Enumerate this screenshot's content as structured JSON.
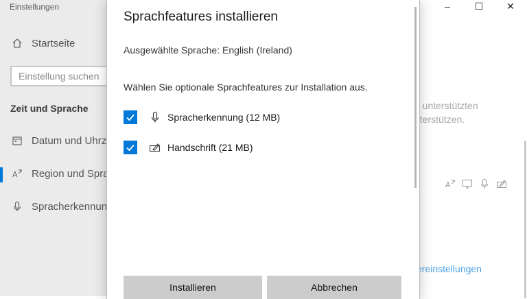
{
  "settings": {
    "app_title": "Einstellungen",
    "home_label": "Startseite",
    "search_placeholder": "Einstellung suchen",
    "section_heading": "Zeit und Sprache",
    "nav": [
      {
        "label": "Datum und Uhrz",
        "icon": "calendar-icon"
      },
      {
        "label": "Region und Spra",
        "icon": "region-language-icon"
      },
      {
        "label": "Spracherkennun",
        "icon": "microphone-icon"
      }
    ],
    "right_text_1": "n unterstützten",
    "right_text_2": "nterstützen.",
    "right_link": "ereinstellungen",
    "right_feature_icons": [
      "text-to-speech-icon",
      "display-language-icon",
      "microphone-icon",
      "handwriting-icon"
    ]
  },
  "window_controls": {
    "minimize": "–",
    "maximize": "☐",
    "close": "✕"
  },
  "dialog": {
    "title": "Sprachfeatures installieren",
    "selected_language": "Ausgewählte Sprache: English (Ireland)",
    "instruction": "Wählen Sie optionale Sprachfeatures zur Installation aus.",
    "features": [
      {
        "label": "Spracherkennung (12 MB)",
        "checked": true,
        "icon": "microphone-icon"
      },
      {
        "label": "Handschrift (21 MB)",
        "checked": true,
        "icon": "handwriting-icon"
      }
    ],
    "install_button": "Installieren",
    "cancel_button": "Abbrechen"
  },
  "colors": {
    "accent": "#0078d7",
    "button_bg": "#cccccc",
    "left_pane_bg": "#ebebeb"
  }
}
